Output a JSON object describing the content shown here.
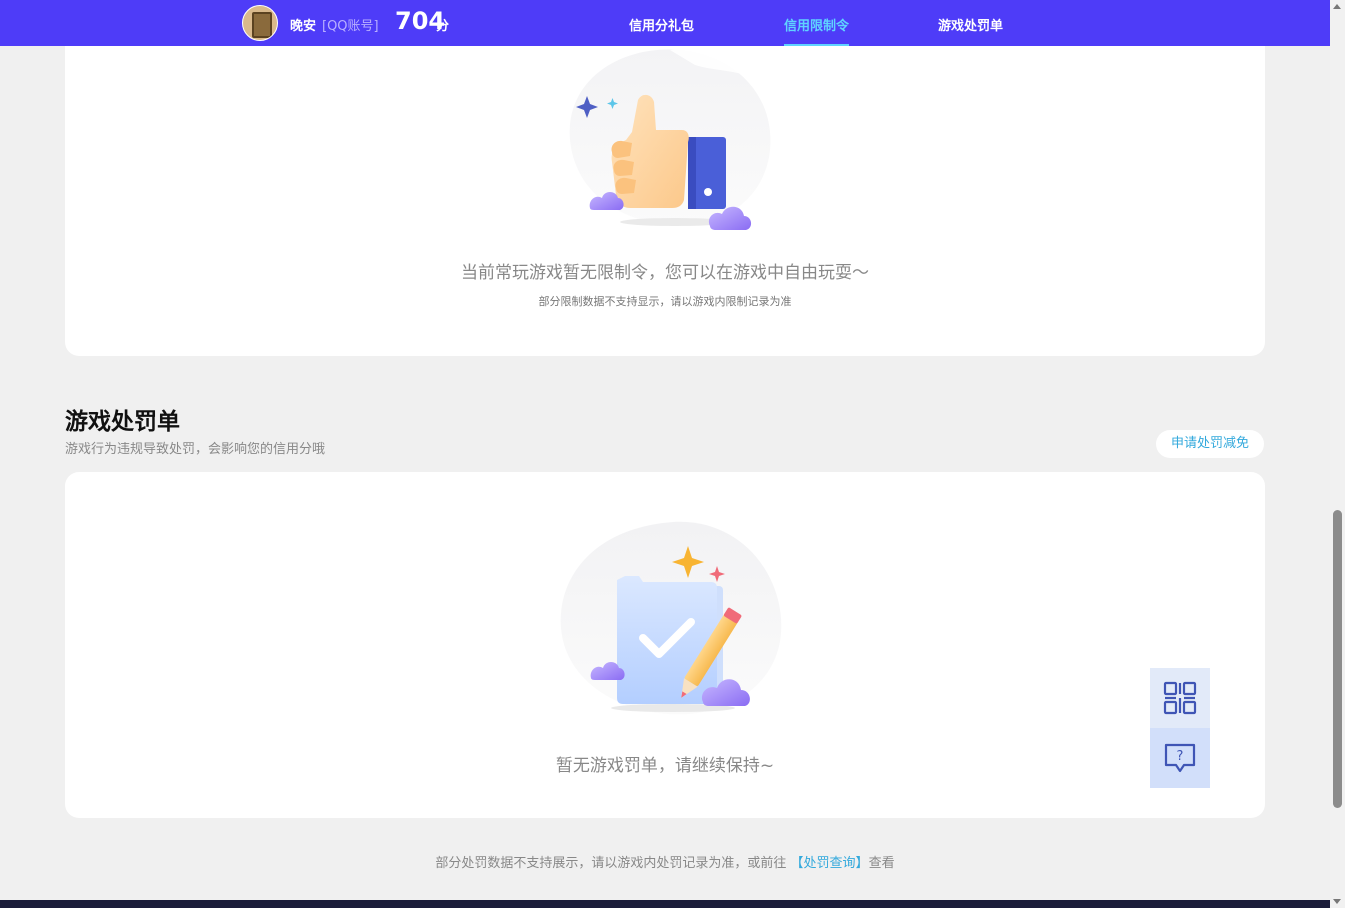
{
  "header": {
    "user_name": "晚安",
    "account_type": "[QQ账号]",
    "score": "704",
    "score_unit": "分",
    "nav": [
      {
        "label": "信用分礼包",
        "active": false
      },
      {
        "label": "信用限制令",
        "active": true
      },
      {
        "label": "游戏处罚单",
        "active": false
      }
    ]
  },
  "restriction": {
    "empty_text": "当前常玩游戏暂无限制令，您可以在游戏中自由玩耍～",
    "note": "部分限制数据不支持显示，请以游戏内限制记录为准",
    "icon": "thumbs-up-illustration"
  },
  "penalty": {
    "title": "游戏处罚单",
    "subtitle": "游戏行为违规导致处罚，会影响您的信用分哦",
    "appeal_button": "申请处罚减免",
    "empty_text": "暂无游戏罚单，请继续保持~",
    "icon": "document-check-illustration"
  },
  "footer": {
    "note_prefix": "部分处罚数据不支持展示，请以游戏内处罚记录为准，或前往 ",
    "link_label": "【处罚查询】",
    "note_suffix": "查看"
  },
  "floating": {
    "qr_icon": "qr-code-icon",
    "help_icon": "help-chat-icon"
  },
  "colors": {
    "nav_bg": "#4e3cf8",
    "nav_active": "#5fd3ff",
    "link": "#33a9dc"
  }
}
